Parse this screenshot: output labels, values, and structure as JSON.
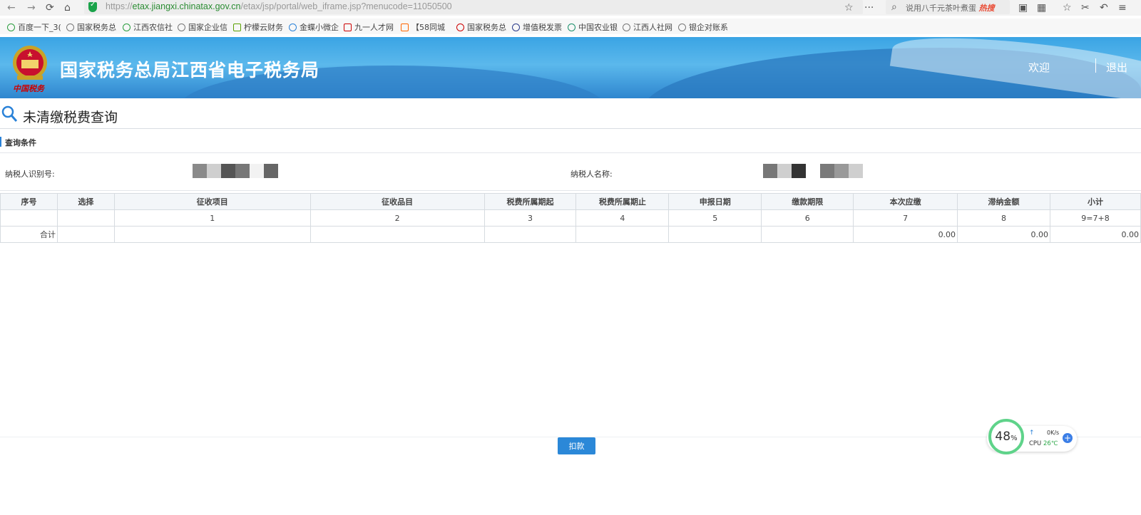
{
  "browser": {
    "url_prefix": "https://",
    "url_host": "etax.jiangxi.chinatax.gov.cn",
    "url_path": "/etax/jsp/portal/web_iframe.jsp?menucode=11050500",
    "search_text": "说用八千元茶叶煮蛋",
    "search_hot": "热搜",
    "bookmarks": [
      "百度一下_3(",
      "国家税务总",
      "江西农信社",
      "国家企业信",
      "柠檬云财务",
      "金蝶小微企",
      "九一人才网",
      "【58同城",
      "国家税务总",
      "增值税发票",
      "中国农业银",
      "江西人社网",
      "银企对账系"
    ]
  },
  "banner": {
    "emblem_text": "中国税务",
    "title": "国家税务总局江西省电子税务局",
    "welcome": "欢迎",
    "logout": "退出"
  },
  "page": {
    "title": "未清缴税费查询",
    "section_title": "查询条件",
    "taxpayer_id_label": "纳税人识别号:",
    "taxpayer_name_label": "纳税人名称:"
  },
  "table": {
    "headers": [
      "序号",
      "选择",
      "征收项目",
      "征收品目",
      "税费所属期起",
      "税费所属期止",
      "申报日期",
      "缴款期限",
      "本次应缴",
      "滞纳金额",
      "小计"
    ],
    "index_row": [
      "",
      "",
      "1",
      "2",
      "3",
      "4",
      "5",
      "6",
      "7",
      "8",
      "9=7+8"
    ],
    "total_label": "合计",
    "totals": [
      "0.00",
      "0.00",
      "0.00"
    ]
  },
  "actions": {
    "pay_label": "扣款"
  },
  "monitor": {
    "percent": "48",
    "percent_unit": "%",
    "speed": "0K/s",
    "cpu_label": "CPU",
    "cpu_temp": "26℃"
  }
}
